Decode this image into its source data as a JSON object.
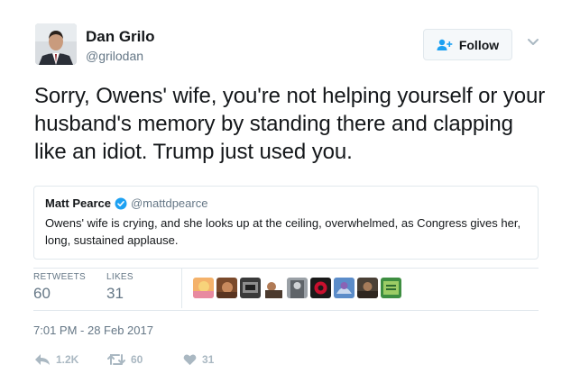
{
  "author": {
    "name": "Dan Grilo",
    "handle": "@grilodan"
  },
  "follow_button": {
    "label": "Follow"
  },
  "tweet": {
    "text": "Sorry, Owens' wife, you're not helping yourself or your husband's memory by standing there and clapping like an idiot. Trump just used you."
  },
  "quoted_tweet": {
    "name": "Matt Pearce",
    "handle": "@mattdpearce",
    "text": "Owens' wife is crying, and she looks up at the ceiling, overwhelmed, as Congress gives her, long, sustained applause."
  },
  "stats": {
    "retweets_label": "RETWEETS",
    "retweets": "60",
    "likes_label": "LIKES",
    "likes": "31"
  },
  "liker_avatars": [
    "avatar-1",
    "avatar-2",
    "avatar-3",
    "avatar-4",
    "avatar-5",
    "avatar-6",
    "avatar-7",
    "avatar-8",
    "avatar-9"
  ],
  "timestamp": "7:01 PM - 28 Feb 2017",
  "actions": {
    "reply_count": "1.2K",
    "retweet_count": "60",
    "like_count": "31"
  },
  "colors": {
    "accent": "#1da1f2",
    "muted": "#657786",
    "icon": "#aab8c2",
    "border": "#e1e8ed"
  }
}
